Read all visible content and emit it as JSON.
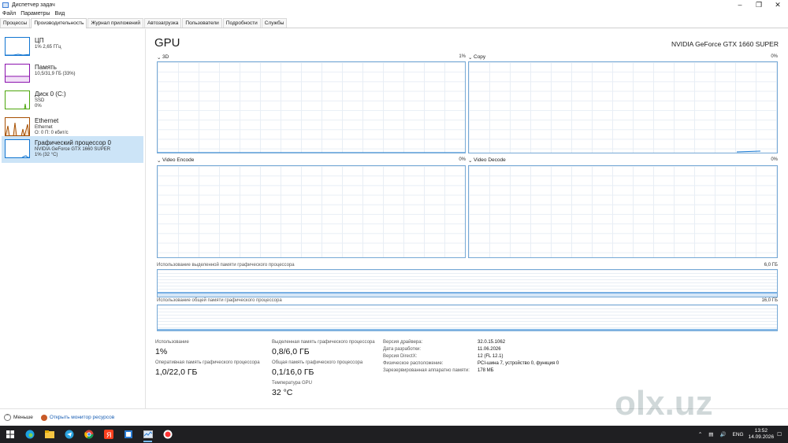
{
  "window": {
    "title": "Диспетчер задач"
  },
  "menu": [
    "Файл",
    "Параметры",
    "Вид"
  ],
  "tabs": [
    "Процессы",
    "Производительность",
    "Журнал приложений",
    "Автозагрузка",
    "Пользователи",
    "Подробности",
    "Службы"
  ],
  "sidebar": {
    "items": [
      {
        "name": "ЦП",
        "sub1": "1% 2,65 ГГц",
        "sub2": "",
        "color": "#1175d1"
      },
      {
        "name": "Память",
        "sub1": "10,5/31,9 ГБ (33%)",
        "sub2": "",
        "color": "#8b12ae"
      },
      {
        "name": "Диск 0 (C:)",
        "sub1": "SSD",
        "sub2": "0%",
        "color": "#4da60c"
      },
      {
        "name": "Ethernet",
        "sub1": "Ethernet",
        "sub2": "О: 0 П: 0 кбит/с",
        "color": "#a74f01"
      },
      {
        "name": "Графический процессор 0",
        "sub1": "NVIDIA GeForce GTX 1660 SUPER",
        "sub2": "1% (32 °C)",
        "color": "#1175d1"
      }
    ]
  },
  "gpu": {
    "title": "GPU",
    "model": "NVIDIA GeForce GTX 1660 SUPER",
    "panels": [
      {
        "label": "3D",
        "value": "1%",
        "symbol": "⌄"
      },
      {
        "label": "Copy",
        "value": "0%",
        "symbol": "⌄"
      },
      {
        "label": "Video Encode",
        "value": "0%",
        "symbol": "⌄"
      },
      {
        "label": "Video Decode",
        "value": "0%",
        "symbol": "⌄"
      }
    ],
    "dedicated_mem": {
      "label": "Использование выделенной памяти графического процессора",
      "max": "6,0 ГБ"
    },
    "shared_mem": {
      "label": "Использование общей памяти графического процессора",
      "max": "16,0 ГБ"
    },
    "stats": {
      "usage_label": "Использование",
      "usage": "1%",
      "ram_label": "Оперативная память графического процессора",
      "ram": "1,0/22,0 ГБ",
      "dedicated_label": "Выделенная память графического процессора",
      "dedicated": "0,8/6,0 ГБ",
      "shared_label": "Общая память графического процессора",
      "shared": "0,1/16,0 ГБ",
      "temp_label": "Температура GPU",
      "temp": "32 °C"
    },
    "info": [
      {
        "k": "Версия драйвера:",
        "v": "32.0.15.1062"
      },
      {
        "k": "Дата разработки:",
        "v": "11.06.2026"
      },
      {
        "k": "Версия DirectX:",
        "v": "12 (FL 12.1)"
      },
      {
        "k": "Физическое расположение:",
        "v": "PCI-шина 7, устройство 0, функция 0"
      },
      {
        "k": "Зарезервированная аппаратно памяти:",
        "v": "178 МБ"
      }
    ]
  },
  "chart_data": {
    "type": "area",
    "title": "3D",
    "ylim": [
      0,
      100
    ],
    "x": [
      0,
      1,
      2,
      3,
      4,
      5,
      6,
      7,
      8,
      9,
      10,
      11,
      12,
      13,
      14,
      15
    ],
    "series": [
      {
        "values": [
          0,
          0,
          0,
          0,
          0,
          0,
          0,
          0,
          0,
          0,
          0,
          0,
          0,
          0,
          0,
          0
        ]
      }
    ]
  },
  "footer": {
    "less": "Меньше",
    "monitor": "Открыть монитор ресурсов"
  },
  "taskbar": {
    "lang": "ENG",
    "time": "13:52",
    "date": "14.09.2026"
  },
  "watermark": "olx.uz"
}
